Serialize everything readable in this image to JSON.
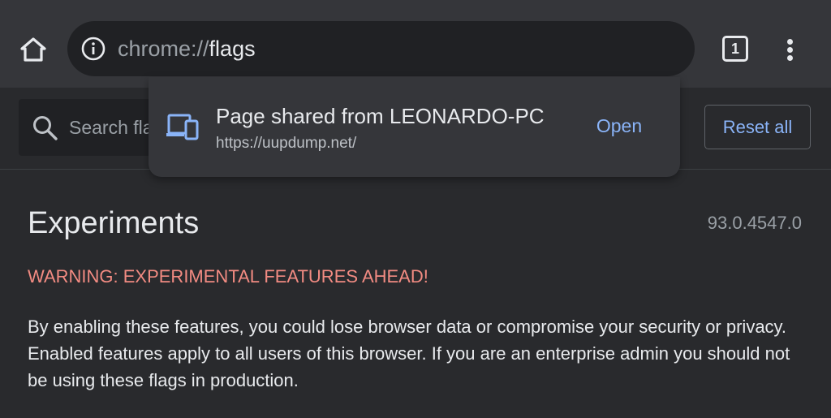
{
  "toolbar": {
    "url_scheme": "chrome://",
    "url_host": "flags",
    "tab_count": "1",
    "icons": [
      "home-icon",
      "info-icon",
      "tab-switcher-icon",
      "more-vert-icon"
    ]
  },
  "popup": {
    "title": "Page shared from LEONARDO-PC",
    "url": "https://uupdump.net/",
    "open_label": "Open",
    "icon": "devices-icon"
  },
  "flags_header": {
    "search_placeholder": "Search flags",
    "reset_label": "Reset all"
  },
  "content": {
    "title": "Experiments",
    "version": "93.0.4547.0",
    "warning": "WARNING: EXPERIMENTAL FEATURES AHEAD!",
    "description": "By enabling these features, you could lose browser data or compromise your security or privacy. Enabled features apply to all users of this browser. If you are an enterprise admin you should not be using these flags in production."
  },
  "colors": {
    "background": "#292a2d",
    "toolbar": "#35363a",
    "omnibox": "#202124",
    "accent_blue": "#8ab4f8",
    "warning_red": "#f28b82"
  }
}
